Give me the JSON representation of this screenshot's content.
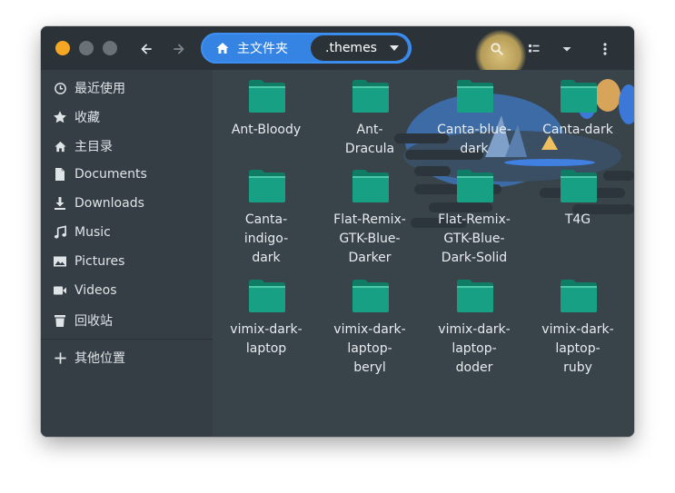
{
  "window": {
    "title": ".themes",
    "colors": {
      "close": "#f5a623",
      "minimize": "#6a7277",
      "maximize": "#6a7277",
      "accent": "#3584e4",
      "folder": "#18a085"
    }
  },
  "header": {
    "back_icon": "arrow-left-icon",
    "forward_icon": "arrow-right-icon",
    "path": [
      {
        "label": "主文件夹",
        "icon": "home-icon"
      },
      {
        "label": ".themes"
      }
    ],
    "search_icon": "search-icon",
    "view_icon": "list-view-icon",
    "sort_icon": "chevron-down-icon",
    "menu_icon": "kebab-menu-icon"
  },
  "sidebar": {
    "items": [
      {
        "label": "最近使用",
        "icon": "clock-icon"
      },
      {
        "label": "收藏",
        "icon": "star-icon"
      },
      {
        "label": "主目录",
        "icon": "home-icon"
      },
      {
        "label": "Documents",
        "icon": "document-icon"
      },
      {
        "label": "Downloads",
        "icon": "download-icon"
      },
      {
        "label": "Music",
        "icon": "music-icon"
      },
      {
        "label": "Pictures",
        "icon": "image-icon"
      },
      {
        "label": "Videos",
        "icon": "video-icon"
      },
      {
        "label": "回收站",
        "icon": "trash-icon"
      },
      {
        "label": "其他位置",
        "icon": "plus-icon"
      }
    ]
  },
  "folders": [
    {
      "name": "Ant-Bloody"
    },
    {
      "name": "Ant-\nDracula"
    },
    {
      "name": "Canta-blue-\ndark"
    },
    {
      "name": "Canta-dark"
    },
    {
      "name": "Canta-\nindigo-\ndark"
    },
    {
      "name": "Flat-Remix-\nGTK-Blue-\nDarker"
    },
    {
      "name": "Flat-Remix-\nGTK-Blue-\nDark-Solid"
    },
    {
      "name": "T4G"
    },
    {
      "name": "vimix-dark-\nlaptop"
    },
    {
      "name": "vimix-dark-\nlaptop-\nberyl"
    },
    {
      "name": "vimix-dark-\nlaptop-\ndoder"
    },
    {
      "name": "vimix-dark-\nlaptop-\nruby"
    }
  ]
}
